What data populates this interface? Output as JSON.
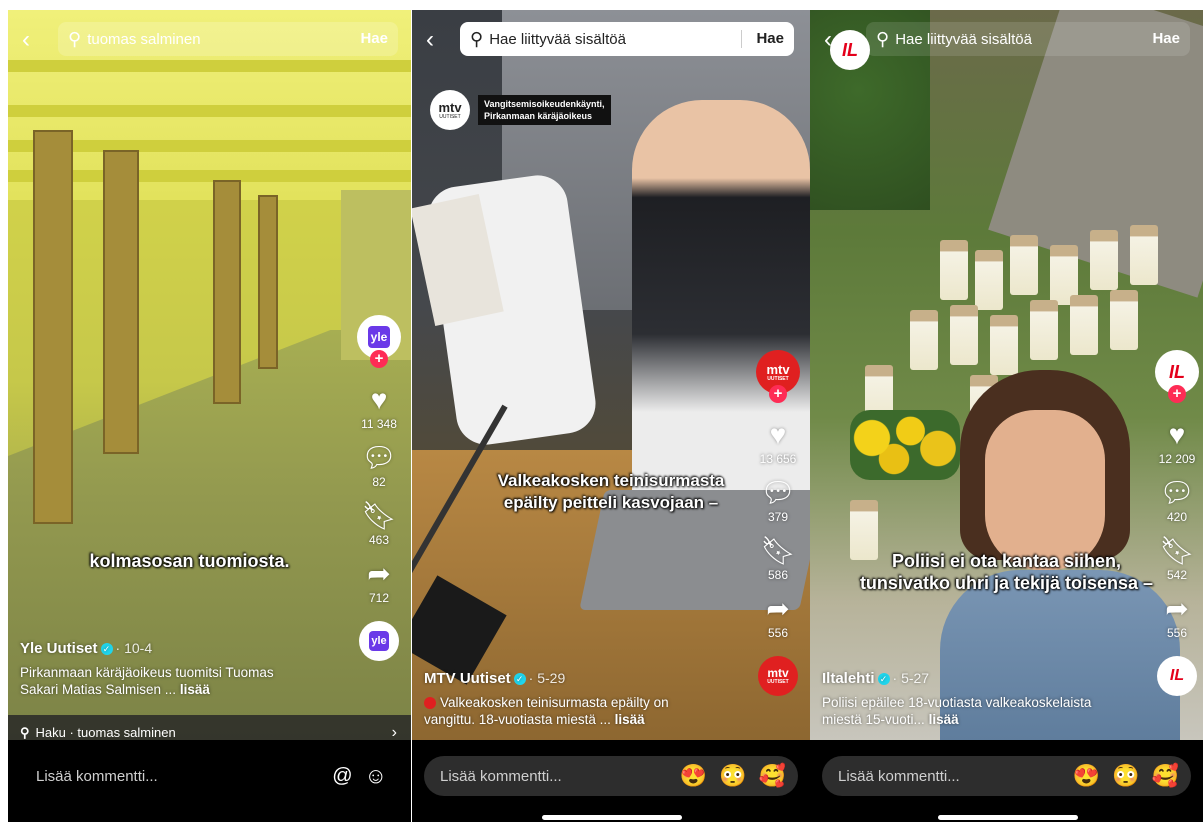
{
  "panels": [
    {
      "search": {
        "text": "tuomas salminen",
        "button": "Hae"
      },
      "account": {
        "avatar_text": "yle",
        "avatar_color": "#6a39e8"
      },
      "actions": {
        "likes": "11 348",
        "comments": "82",
        "saves": "463",
        "shares": "712"
      },
      "caption": "kolmasosan tuomiosta.",
      "author": "Yle Uutiset",
      "date": "· 10-4",
      "description": "Pirkanmaan käräjäoikeus tuomitsi Tuomas Sakari Matias Salmisen ...",
      "more": "lisää",
      "search_suggestion": {
        "label": "Haku · tuomas salminen"
      },
      "comment": {
        "placeholder": "Lisää kommentti...",
        "at_icon": "@",
        "emoji_icon": "☺"
      }
    },
    {
      "search": {
        "text": "Hae liittyvää sisältöä",
        "button": "Hae"
      },
      "badge": {
        "logo": "mtv",
        "logo_sub": "UUTISET",
        "title_line1": "Vangitsemisoikeudenkäynti,",
        "title_line2": "Pirkanmaan käräjäoikeus"
      },
      "account": {
        "avatar_text": "mtv",
        "avatar_sub": "UUTISET",
        "avatar_color": "#e02020"
      },
      "actions": {
        "likes": "13 656",
        "comments": "379",
        "saves": "586",
        "shares": "556"
      },
      "caption_line1": "Valkeakosken teinisurmasta",
      "caption_line2": "epäilty peitteli kasvojaan –",
      "author": "MTV Uutiset",
      "date": "· 5-29",
      "description": "Valkeakosken teinisurmasta epäilty on vangittu.  18-vuotiasta miestä ...",
      "more": "lisää",
      "comment": {
        "placeholder": "Lisää kommentti...",
        "emoji_1": "😍",
        "emoji_2": "😳",
        "emoji_3": "🥰"
      }
    },
    {
      "search": {
        "text": "Hae liittyvää sisältöä",
        "button": "Hae"
      },
      "account": {
        "avatar_text": "IL",
        "avatar_color": "#ffffff",
        "logo_color": "#e4001b"
      },
      "actions": {
        "likes": "12 209",
        "comments": "420",
        "saves": "542",
        "shares": "556"
      },
      "caption_line1": "Poliisi ei ota kantaa siihen,",
      "caption_line2": "tunsivatko uhri ja tekijä toisensa –",
      "author": "Iltalehti",
      "date": "· 5-27",
      "description": "Poliisi epäilee 18-vuotiasta valkeakoskelaista miestä 15-vuoti...",
      "more": "lisää",
      "comment": {
        "placeholder": "Lisää kommentti...",
        "emoji_1": "😍",
        "emoji_2": "😳",
        "emoji_3": "🥰"
      }
    }
  ]
}
